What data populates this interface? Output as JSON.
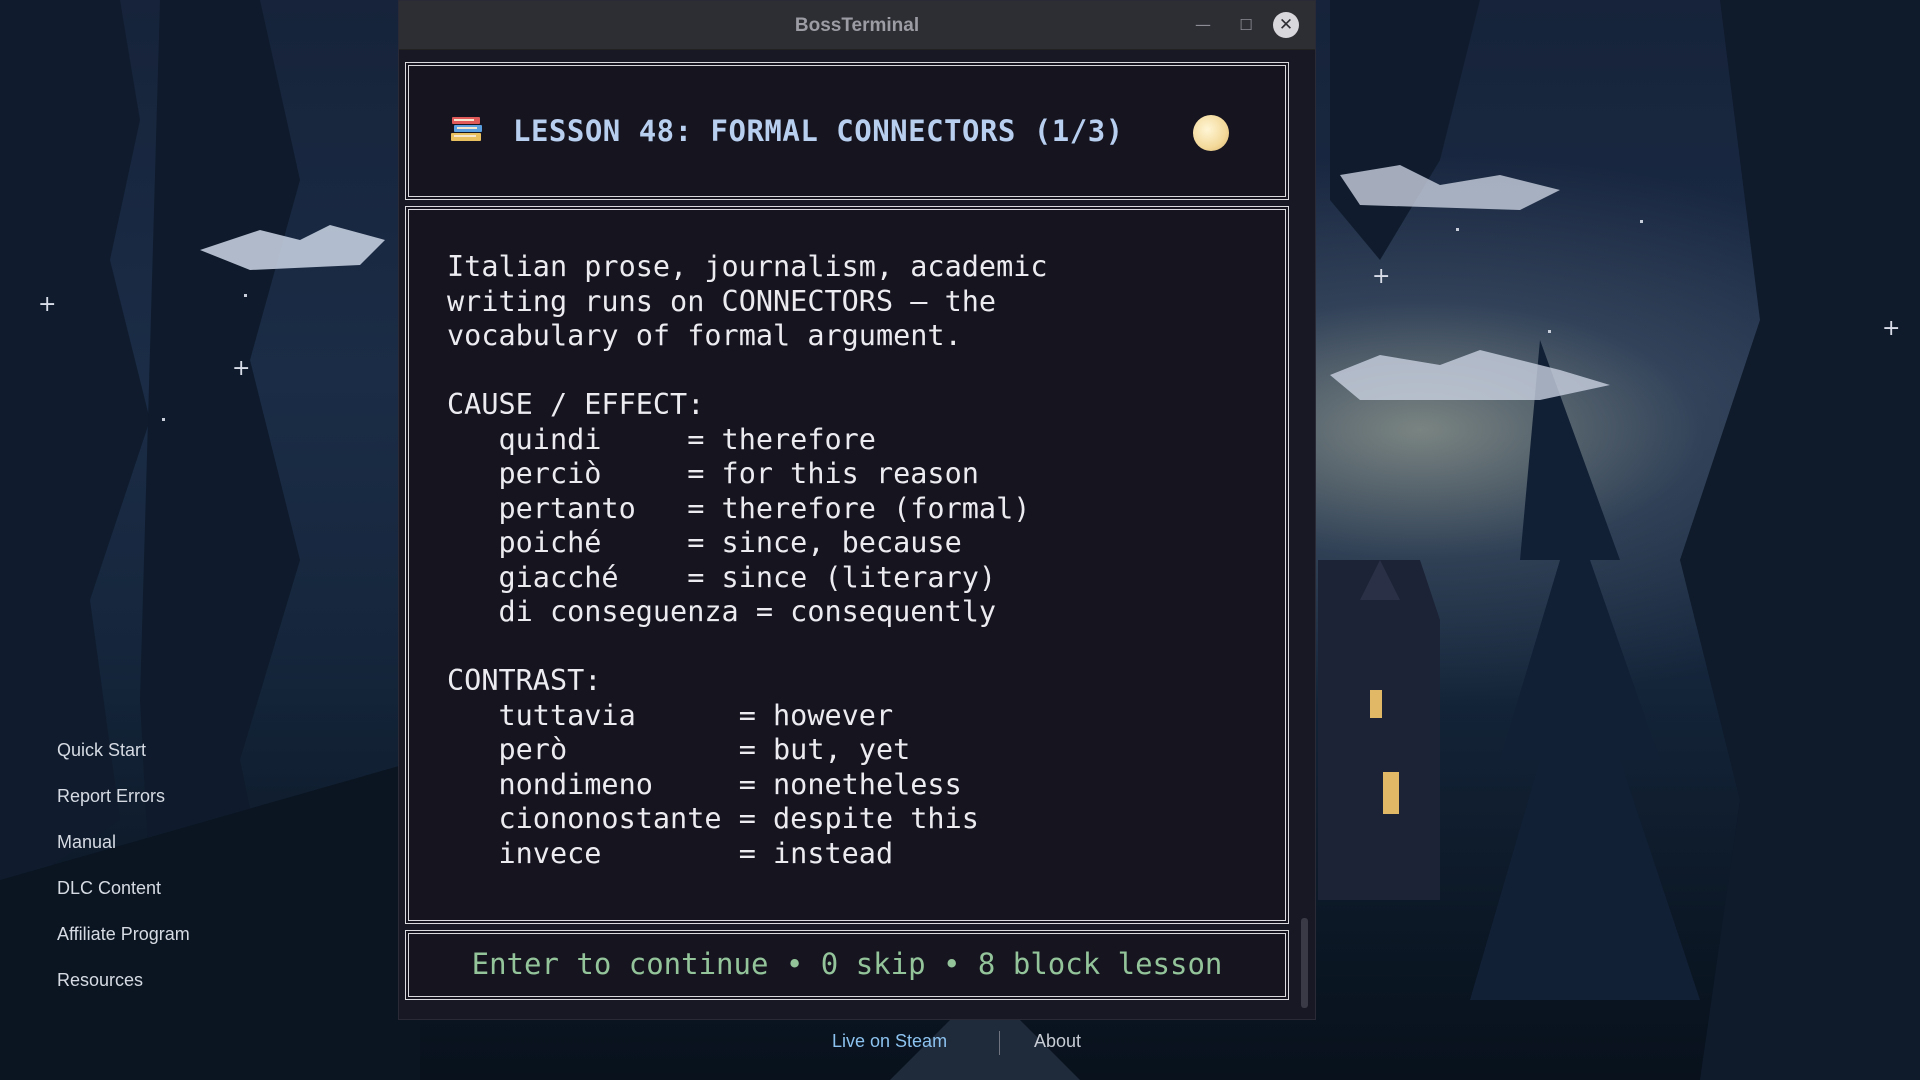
{
  "window": {
    "title": "BossTerminal",
    "minimize_icon": "—",
    "maximize_icon": "☐",
    "close_icon": "✕"
  },
  "sidebar": {
    "items": [
      {
        "label": "Quick Start"
      },
      {
        "label": "Report Errors"
      },
      {
        "label": "Manual"
      },
      {
        "label": "DLC Content"
      },
      {
        "label": "Affiliate Program"
      },
      {
        "label": "Resources"
      }
    ]
  },
  "lesson": {
    "icon": "books-icon",
    "title": "LESSON 48: FORMAL CONNECTORS (1/3)",
    "status_icon": "moon-icon",
    "body": "Italian prose, journalism, academic\nwriting runs on CONNECTORS — the\nvocabulary of formal argument.\n\nCAUSE / EFFECT:\n   quindi     = therefore\n   perciò     = for this reason\n   pertanto   = therefore (formal)\n   poiché     = since, because\n   giacché    = since (literary)\n   di conseguenza = consequently\n\nCONTRAST:\n   tuttavia      = however\n   però          = but, yet\n   nondimeno     = nonetheless\n   ciononostante = despite this\n   invece        = instead",
    "footer": "Enter to continue • 0 skip • 8 block lesson"
  },
  "bottom": {
    "live_label": "Live on Steam",
    "about_label": "About"
  },
  "colors": {
    "title_color": "#b8cff0",
    "footer_color": "#93c49a",
    "link_color": "#8cc2ef"
  }
}
